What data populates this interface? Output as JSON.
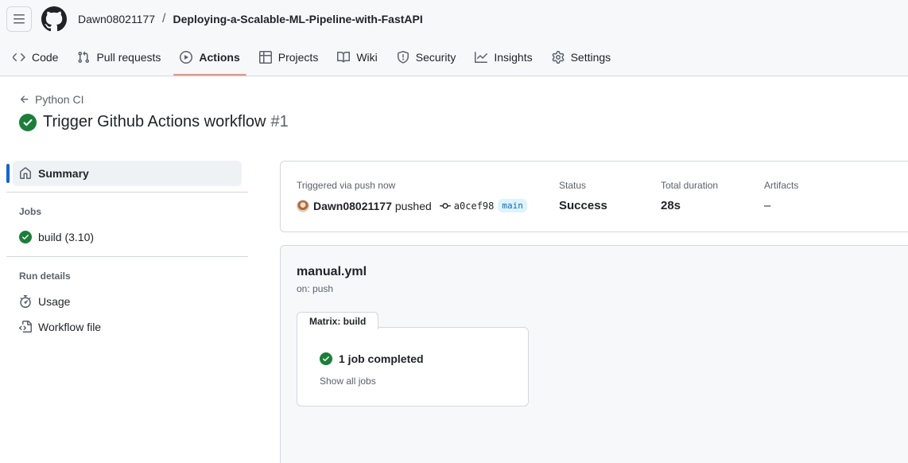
{
  "header": {
    "owner": "Dawn08021177",
    "separator": "/",
    "repo": "Deploying-a-Scalable-ML-Pipeline-with-FastAPI"
  },
  "tabs": [
    {
      "label": "Code",
      "icon": "code-icon"
    },
    {
      "label": "Pull requests",
      "icon": "git-pull-request-icon"
    },
    {
      "label": "Actions",
      "icon": "play-icon",
      "active": true
    },
    {
      "label": "Projects",
      "icon": "table-icon"
    },
    {
      "label": "Wiki",
      "icon": "book-icon"
    },
    {
      "label": "Security",
      "icon": "shield-icon"
    },
    {
      "label": "Insights",
      "icon": "graph-icon"
    },
    {
      "label": "Settings",
      "icon": "gear-icon"
    }
  ],
  "run": {
    "back_label": "Python CI",
    "title": "Trigger Github Actions workflow",
    "number": "#1"
  },
  "sidebar": {
    "summary": "Summary",
    "jobs_heading": "Jobs",
    "job": "build (3.10)",
    "run_details_heading": "Run details",
    "usage": "Usage",
    "workflow_file": "Workflow file"
  },
  "summary": {
    "triggered_label": "Triggered via push now",
    "user": "Dawn08021177",
    "pushed": "pushed",
    "commit": "a0cef98",
    "branch": "main",
    "status_label": "Status",
    "status_value": "Success",
    "duration_label": "Total duration",
    "duration_value": "28s",
    "artifacts_label": "Artifacts",
    "artifacts_value": "–"
  },
  "graph": {
    "workflow_name": "manual.yml",
    "on": "on: push",
    "matrix_label": "Matrix: build",
    "jobs_completed": "1 job completed",
    "show_all": "Show all jobs"
  },
  "colors": {
    "success": "#1a7f37",
    "active_tab_underline": "#fd8c73",
    "accent": "#0969da"
  }
}
